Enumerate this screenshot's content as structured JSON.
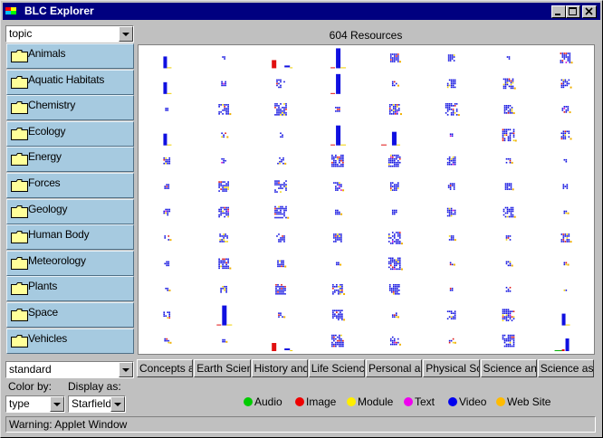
{
  "window": {
    "title": "BLC Explorer"
  },
  "topic_select": {
    "value": "topic"
  },
  "resources_label": "604 Resources",
  "topics": [
    "Animals",
    "Aquatic Habitats",
    "Chemistry",
    "Ecology",
    "Energy",
    "Forces",
    "Geology",
    "Human Body",
    "Meteorology",
    "Plants",
    "Space",
    "Vehicles"
  ],
  "mode_select": {
    "value": "standard"
  },
  "tabs": [
    "Concepts ar",
    "Earth Scien",
    "History and",
    "Life Science",
    "Personal an",
    "Physical Sci",
    "Science anc",
    "Science as"
  ],
  "color_by": {
    "label": "Color by:",
    "value": "type"
  },
  "display_as": {
    "label": "Display as:",
    "value": "Starfield"
  },
  "legend": [
    {
      "label": "Audio",
      "color": "#00cc00"
    },
    {
      "label": "Image",
      "color": "#ee0000"
    },
    {
      "label": "Module",
      "color": "#ffee00"
    },
    {
      "label": "Text",
      "color": "#ee00ee"
    },
    {
      "label": "Video",
      "color": "#0000ee"
    },
    {
      "label": "Web Site",
      "color": "#ffbb00"
    }
  ],
  "status": "Warning: Applet Window",
  "glyph_colors": {
    "blue": "#1010e0",
    "red": "#e01010",
    "yellow": "#f0d000",
    "orange": "#f0b000",
    "magenta": "#d000d0",
    "green": "#00b000"
  }
}
